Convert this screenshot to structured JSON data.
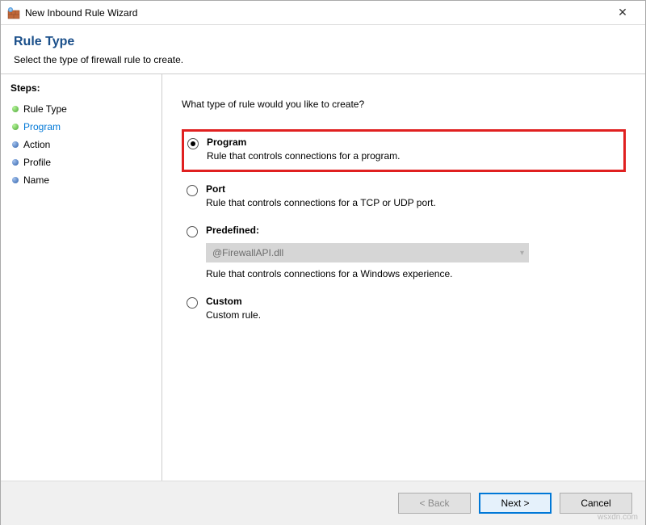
{
  "window": {
    "title": "New Inbound Rule Wizard"
  },
  "header": {
    "title": "Rule Type",
    "subtitle": "Select the type of firewall rule to create."
  },
  "sidebar": {
    "label": "Steps:",
    "steps": [
      {
        "label": "Rule Type",
        "state": "done"
      },
      {
        "label": "Program",
        "state": "active"
      },
      {
        "label": "Action",
        "state": "todo"
      },
      {
        "label": "Profile",
        "state": "todo"
      },
      {
        "label": "Name",
        "state": "todo"
      }
    ]
  },
  "content": {
    "question": "What type of rule would you like to create?",
    "options": {
      "program": {
        "title": "Program",
        "desc": "Rule that controls connections for a program."
      },
      "port": {
        "title": "Port",
        "desc": "Rule that controls connections for a TCP or UDP port."
      },
      "predefined": {
        "title": "Predefined:",
        "dropdown": "@FirewallAPI.dll",
        "desc": "Rule that controls connections for a Windows experience."
      },
      "custom": {
        "title": "Custom",
        "desc": "Custom rule."
      }
    }
  },
  "footer": {
    "back": "< Back",
    "next": "Next >",
    "cancel": "Cancel"
  },
  "watermark": "wsxdn.com"
}
